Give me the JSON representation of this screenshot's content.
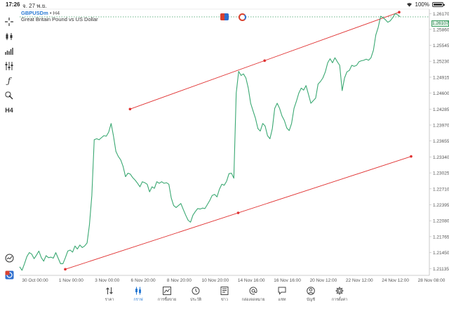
{
  "status_bar": {
    "time": "17:26",
    "date": "จ. 27 พ.ย.",
    "battery": "100%"
  },
  "symbol": {
    "name": "GBPUSDm",
    "timeframe": "• H4",
    "description": "Great Britain Pound vs US Dollar"
  },
  "toolbar": {
    "items": [
      {
        "name": "crosshair-icon",
        "label": ""
      },
      {
        "name": "candles-icon",
        "label": ""
      },
      {
        "name": "bars-icon",
        "label": ""
      },
      {
        "name": "settings-sliders-icon",
        "label": ""
      },
      {
        "name": "function-icon",
        "label": "ƒ"
      },
      {
        "name": "draw-objects-icon",
        "label": ""
      },
      {
        "name": "timeframe-button",
        "label": "H4"
      }
    ]
  },
  "price_axis": {
    "ticks": [
      "1.26170",
      "1.25860",
      "1.25545",
      "1.25230",
      "1.24915",
      "1.24600",
      "1.24285",
      "1.23970",
      "1.23655",
      "1.23340",
      "1.23025",
      "1.22710",
      "1.22395",
      "1.22080",
      "1.21765",
      "1.21450",
      "1.21135"
    ],
    "current_price": "1.26107"
  },
  "time_axis": {
    "ticks": [
      "30 Oct 00:00",
      "1 Nov 00:00",
      "3 Nov 00:00",
      "6 Nov 20:00",
      "8 Nov 20:00",
      "10 Nov 20:00",
      "14 Nov 16:00",
      "16 Nov 16:00",
      "20 Nov 12:00",
      "22 Nov 12:00",
      "24 Nov 12:00",
      "28 Nov 08:00"
    ]
  },
  "chart_data": {
    "type": "line",
    "series": [
      {
        "values": [
          1.2117,
          1.211,
          1.2123,
          1.2137,
          1.2145,
          1.2142,
          1.2133,
          1.214,
          1.2148,
          1.2135,
          1.2128,
          1.2139,
          1.2135,
          1.2136,
          1.2134,
          1.2145,
          1.2134,
          1.2123,
          1.2123,
          1.2135,
          1.2148,
          1.215,
          1.2146,
          1.2158,
          1.2152,
          1.216,
          1.2155,
          1.2158,
          1.2164,
          1.22,
          1.2258,
          1.2368,
          1.237,
          1.2368,
          1.2372,
          1.2376,
          1.2375,
          1.2383,
          1.24,
          1.2375,
          1.2345,
          1.2335,
          1.2328,
          1.2315,
          1.2295,
          1.2302,
          1.23,
          1.2293,
          1.2288,
          1.2282,
          1.2275,
          1.2285,
          1.2283,
          1.228,
          1.2265,
          1.2275,
          1.2272,
          1.2285,
          1.2282,
          1.2285,
          1.2282,
          1.2283,
          1.228,
          1.2253,
          1.2238,
          1.2234,
          1.2238,
          1.2242,
          1.223,
          1.2219,
          1.2209,
          1.2205,
          1.2219,
          1.2226,
          1.2232,
          1.2231,
          1.2233,
          1.2232,
          1.224,
          1.2248,
          1.2258,
          1.226,
          1.2255,
          1.227,
          1.228,
          1.2278,
          1.2286,
          1.2301,
          1.2302,
          1.2292,
          1.246,
          1.2503,
          1.2495,
          1.2498,
          1.249,
          1.247,
          1.244,
          1.2425,
          1.241,
          1.239,
          1.2385,
          1.24,
          1.2395,
          1.2376,
          1.237,
          1.239,
          1.243,
          1.244,
          1.243,
          1.2415,
          1.2406,
          1.2391,
          1.2386,
          1.24,
          1.243,
          1.2444,
          1.246,
          1.247,
          1.2466,
          1.2475,
          1.2458,
          1.244,
          1.2445,
          1.245,
          1.2478,
          1.2483,
          1.249,
          1.2502,
          1.252,
          1.2528,
          1.252,
          1.253,
          1.2522,
          1.2515,
          1.2465,
          1.249,
          1.2502,
          1.2505,
          1.2515,
          1.2513,
          1.2515,
          1.2522,
          1.2524,
          1.2525,
          1.2527,
          1.2525,
          1.253,
          1.2545,
          1.2575,
          1.259,
          1.2612,
          1.2609,
          1.2605,
          1.26,
          1.2603,
          1.2609,
          1.2617,
          1.2615,
          1.2611
        ]
      }
    ],
    "trend_channel": {
      "color": "#e03030",
      "upper": [
        [
          0.28,
          1.24285
        ],
        [
          1.0,
          1.262
        ]
      ],
      "lower": [
        [
          0.0,
          1.2112
        ],
        [
          1.0,
          1.2335
        ]
      ]
    },
    "ylim": [
      1.21,
      1.2626
    ],
    "line_color": "#3aa872",
    "grid": false,
    "xlabel": "",
    "ylabel": ""
  },
  "bottom_nav": {
    "items": [
      {
        "id": "quotes",
        "icon": "updown-arrows-icon",
        "label": "ราคา"
      },
      {
        "id": "chart",
        "icon": "candles-icon",
        "label": "กราฟ",
        "active": true
      },
      {
        "id": "trade",
        "icon": "trade-chart-icon",
        "label": "การซื้อขาย"
      },
      {
        "id": "history",
        "icon": "history-icon",
        "label": "ประวัติ"
      },
      {
        "id": "news",
        "icon": "news-icon",
        "label": "ข่าว"
      },
      {
        "id": "mailbox",
        "icon": "at-icon",
        "label": "กล่องจดหมาย"
      },
      {
        "id": "chat",
        "icon": "chat-icon",
        "label": "แชท"
      },
      {
        "id": "accounts",
        "icon": "account-icon",
        "label": "บัญชี"
      },
      {
        "id": "settings",
        "icon": "gear-icon",
        "label": "การตั้งค่า"
      }
    ],
    "active_color": "#2a7bd4"
  }
}
